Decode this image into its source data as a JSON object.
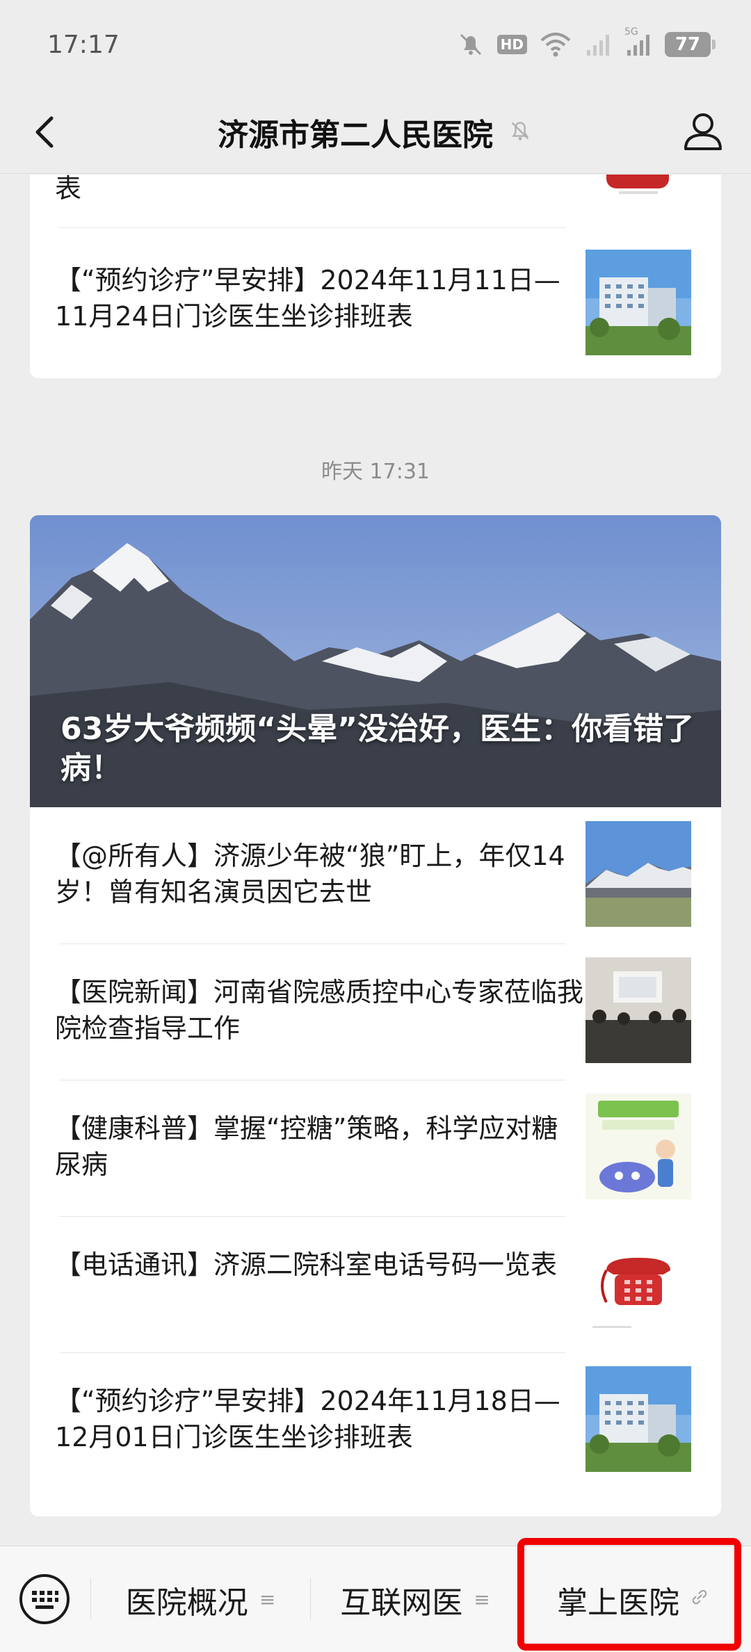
{
  "status_bar": {
    "time": "17:17",
    "battery": "77",
    "hd": "HD",
    "net": "5G"
  },
  "header": {
    "title": "济源市第二人民医院"
  },
  "top_card": {
    "partial_title": "表",
    "items": [
      {
        "title": "【“预约诊疗”早安排】2024年11月11日—11月24日门诊医生坐诊排班表",
        "thumb": "hospital-building"
      }
    ]
  },
  "timestamp": "昨天 17:31",
  "main_card": {
    "hero_title": "63岁大爷频频“头晕”没治好，医生：你看错了病！",
    "items": [
      {
        "title": "【@所有人】济源少年被“狼”盯上，年仅14岁！曾有知名演员因它去世",
        "thumb": "mountain"
      },
      {
        "title": "【医院新闻】河南省院感质控中心专家莅临我院检查指导工作",
        "thumb": "meeting-room"
      },
      {
        "title": "【健康科普】掌握“控糖”策略，科学应对糖尿病",
        "thumb": "diabetes-cartoon"
      },
      {
        "title": "【电话通讯】济源二院科室电话号码一览表",
        "thumb": "red-telephone"
      },
      {
        "title": "【“预约诊疗”早安排】2024年11月18日—12月01日门诊医生坐诊排班表",
        "thumb": "hospital-building"
      }
    ]
  },
  "bottom_menu": {
    "items": [
      {
        "label": "医院概况"
      },
      {
        "label": "互联网医"
      },
      {
        "label": "掌上医院"
      }
    ]
  },
  "colors": {
    "highlight": "#f00000",
    "background": "#ededed"
  }
}
